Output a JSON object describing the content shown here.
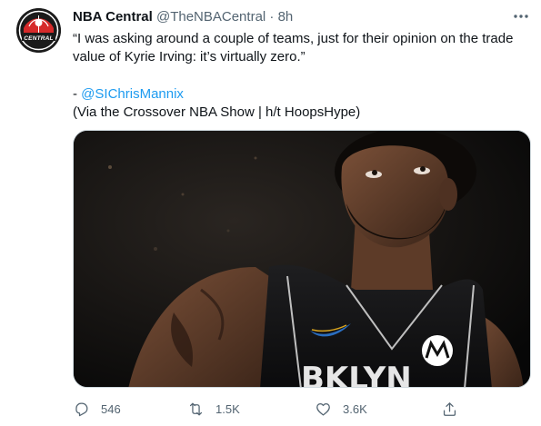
{
  "author": {
    "name": "NBA Central",
    "handle": "@TheNBACentral",
    "separator": "·",
    "time": "8h",
    "avatar_text": "CENTRAL"
  },
  "tweet": {
    "quote": "“I was asking around a couple of teams, just for their opinion on the trade value of Kyrie Irving: it’s virtually zero.”",
    "credit_prefix": "- ",
    "mention": "@SIChrisMannix",
    "via": "(Via the Crossover NBA Show | h/t HoopsHype)"
  },
  "media": {
    "jersey_text": "BKLYN"
  },
  "actions": {
    "replies": "546",
    "retweets": "1.5K",
    "likes": "3.6K"
  },
  "icons": {
    "more": "more-dots-icon",
    "reply": "reply-icon",
    "retweet": "retweet-icon",
    "like": "heart-icon",
    "share": "share-icon"
  },
  "colors": {
    "link": "#1d9bf0",
    "secondary_text": "#536471",
    "primary_text": "#0f1419"
  }
}
